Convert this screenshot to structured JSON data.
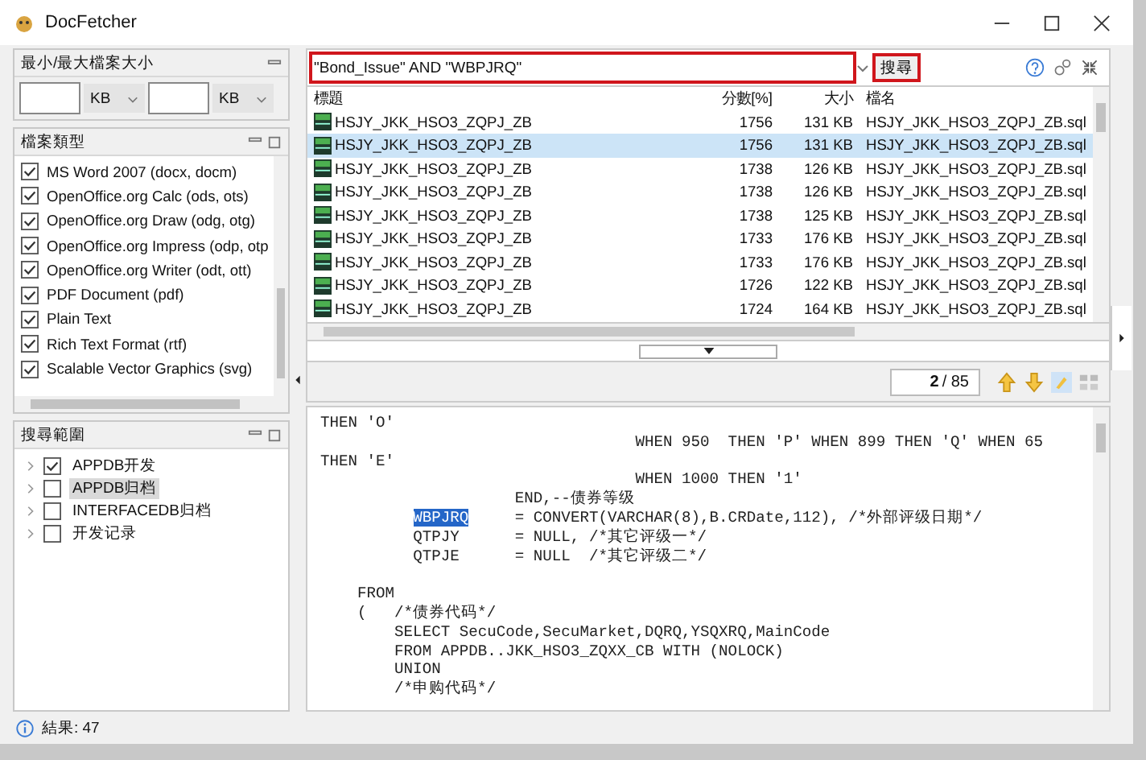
{
  "window": {
    "title": "DocFetcher"
  },
  "size_filter": {
    "title": "最小/最大檔案大小",
    "min_unit": "KB",
    "max_unit": "KB"
  },
  "file_types": {
    "title": "檔案類型",
    "items": [
      {
        "label": "MS Word 2007 (docx, docm)",
        "checked": true
      },
      {
        "label": "OpenOffice.org Calc (ods, ots)",
        "checked": true
      },
      {
        "label": "OpenOffice.org Draw (odg, otg)",
        "checked": true
      },
      {
        "label": "OpenOffice.org Impress (odp, otp",
        "checked": true
      },
      {
        "label": "OpenOffice.org Writer (odt, ott)",
        "checked": true
      },
      {
        "label": "PDF Document (pdf)",
        "checked": true
      },
      {
        "label": "Plain Text",
        "checked": true
      },
      {
        "label": "Rich Text Format (rtf)",
        "checked": true
      },
      {
        "label": "Scalable Vector Graphics (svg)",
        "checked": true
      }
    ]
  },
  "search_scope": {
    "title": "搜尋範圍",
    "items": [
      {
        "label": "APPDB开发",
        "checked": true,
        "selected": false,
        "expanded": false
      },
      {
        "label": "APPDB归档",
        "checked": false,
        "selected": true,
        "expanded": false
      },
      {
        "label": "INTERFACEDB归档",
        "checked": false,
        "selected": false,
        "expanded": false
      },
      {
        "label": "开发记录",
        "checked": false,
        "selected": false,
        "expanded": false
      }
    ]
  },
  "search": {
    "query": "\"Bond_Issue\" AND \"WBPJRQ\"",
    "button": "搜尋"
  },
  "table": {
    "columns": [
      "標題",
      "分數[%]",
      "大小",
      "檔名"
    ],
    "rows": [
      {
        "title": "HSJY_JKK_HSO3_ZQPJ_ZB",
        "score": "1756",
        "size": "131 KB",
        "filename": "HSJY_JKK_HSO3_ZQPJ_ZB.sql",
        "selected": false
      },
      {
        "title": "HSJY_JKK_HSO3_ZQPJ_ZB",
        "score": "1756",
        "size": "131 KB",
        "filename": "HSJY_JKK_HSO3_ZQPJ_ZB.sql",
        "selected": true
      },
      {
        "title": "HSJY_JKK_HSO3_ZQPJ_ZB",
        "score": "1738",
        "size": "126 KB",
        "filename": "HSJY_JKK_HSO3_ZQPJ_ZB.sql",
        "selected": false
      },
      {
        "title": "HSJY_JKK_HSO3_ZQPJ_ZB",
        "score": "1738",
        "size": "126 KB",
        "filename": "HSJY_JKK_HSO3_ZQPJ_ZB.sql",
        "selected": false
      },
      {
        "title": "HSJY_JKK_HSO3_ZQPJ_ZB",
        "score": "1738",
        "size": "125 KB",
        "filename": "HSJY_JKK_HSO3_ZQPJ_ZB.sql",
        "selected": false
      },
      {
        "title": "HSJY_JKK_HSO3_ZQPJ_ZB",
        "score": "1733",
        "size": "176 KB",
        "filename": "HSJY_JKK_HSO3_ZQPJ_ZB.sql",
        "selected": false
      },
      {
        "title": "HSJY_JKK_HSO3_ZQPJ_ZB",
        "score": "1733",
        "size": "176 KB",
        "filename": "HSJY_JKK_HSO3_ZQPJ_ZB.sql",
        "selected": false
      },
      {
        "title": "HSJY_JKK_HSO3_ZQPJ_ZB",
        "score": "1726",
        "size": "122 KB",
        "filename": "HSJY_JKK_HSO3_ZQPJ_ZB.sql",
        "selected": false
      },
      {
        "title": "HSJY_JKK_HSO3_ZQPJ_ZB",
        "score": "1724",
        "size": "164 KB",
        "filename": "HSJY_JKK_HSO3_ZQPJ_ZB.sql",
        "selected": false
      }
    ]
  },
  "navigation": {
    "current": "2",
    "total": "/ 85"
  },
  "preview": {
    "lines": [
      {
        "kind": "then",
        "segments": [
          {
            "text": "THEN 'O'",
            "highlighted": false
          }
        ]
      },
      {
        "kind": "when",
        "segments": [
          {
            "text": "WHEN 950  THEN 'P' WHEN 899 THEN 'Q' WHEN 65",
            "highlighted": false
          }
        ]
      },
      {
        "kind": "then",
        "segments": [
          {
            "text": "THEN 'E'",
            "highlighted": false
          }
        ]
      },
      {
        "kind": "when",
        "segments": [
          {
            "text": "WHEN 1000 THEN '1'",
            "highlighted": false
          }
        ]
      },
      {
        "kind": "end",
        "segments": [
          {
            "text": "END,--债券等级",
            "highlighted": false
          }
        ]
      },
      {
        "kind": "assign",
        "segments": [
          {
            "text": "WBPJRQ",
            "highlighted": true
          },
          {
            "text": "     = CONVERT(VARCHAR(8),B.CRDate,112), /*外部评级日期*/",
            "highlighted": false
          }
        ]
      },
      {
        "kind": "assign",
        "segments": [
          {
            "text": "QTPJY      = NULL, /*其它评级一*/",
            "highlighted": false
          }
        ]
      },
      {
        "kind": "assign",
        "segments": [
          {
            "text": "QTPJE      = NULL  /*其它评级二*/",
            "highlighted": false
          }
        ]
      },
      {
        "kind": "blank"
      },
      {
        "kind": "clause",
        "segments": [
          {
            "text": "FROM",
            "highlighted": false
          }
        ]
      },
      {
        "kind": "clause",
        "segments": [
          {
            "text": "(   /*债券代码*/",
            "highlighted": false
          }
        ]
      },
      {
        "kind": "sub",
        "segments": [
          {
            "text": "SELECT SecuCode,SecuMarket,DQRQ,YSQXRQ,MainCode",
            "highlighted": false
          }
        ]
      },
      {
        "kind": "sub",
        "segments": [
          {
            "text": "FROM APPDB..JKK_HSO3_ZQXX_CB WITH (NOLOCK)",
            "highlighted": false
          }
        ]
      },
      {
        "kind": "sub",
        "segments": [
          {
            "text": "UNION",
            "highlighted": false
          }
        ]
      },
      {
        "kind": "sub",
        "segments": [
          {
            "text": "/*申购代码*/",
            "highlighted": false
          }
        ]
      }
    ]
  },
  "status_bar": {
    "text": "結果: 47"
  }
}
